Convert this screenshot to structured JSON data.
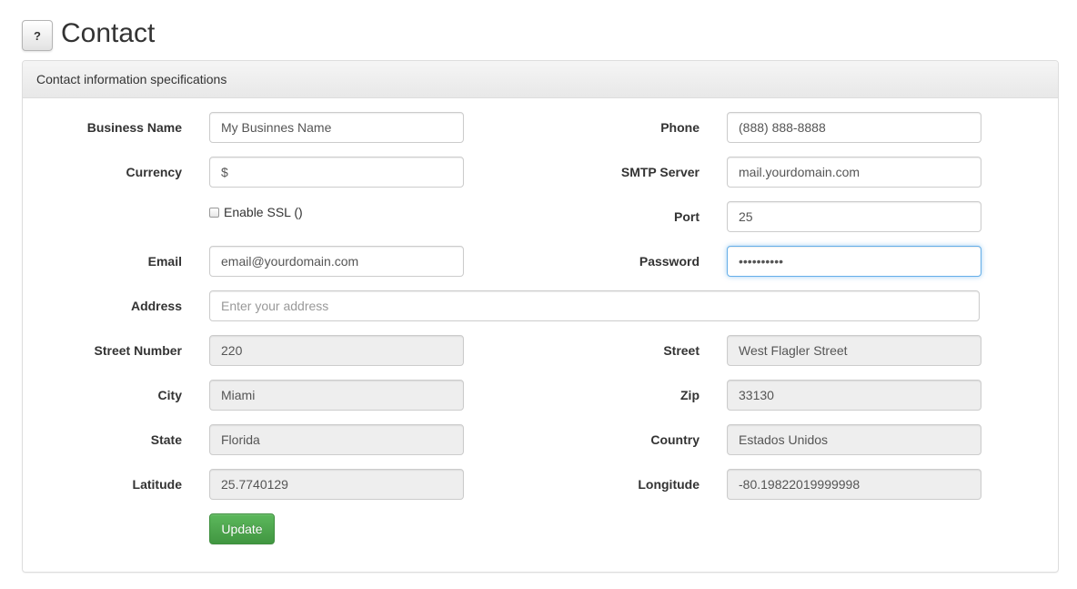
{
  "header": {
    "help_label": "?",
    "title": "Contact"
  },
  "panel": {
    "heading": "Contact information specifications"
  },
  "form": {
    "business_name": {
      "label": "Business Name",
      "value": "My Businnes Name"
    },
    "currency": {
      "label": "Currency",
      "value": "$"
    },
    "enable_ssl": {
      "label": "Enable SSL ()",
      "checked": false
    },
    "email": {
      "label": "Email",
      "value": "email@yourdomain.com"
    },
    "address": {
      "label": "Address",
      "value": "",
      "placeholder": "Enter your address"
    },
    "street_number": {
      "label": "Street Number",
      "value": "220"
    },
    "city": {
      "label": "City",
      "value": "Miami"
    },
    "state": {
      "label": "State",
      "value": "Florida"
    },
    "latitude": {
      "label": "Latitude",
      "value": "25.7740129"
    },
    "phone": {
      "label": "Phone",
      "value": "(888) 888-8888"
    },
    "smtp_server": {
      "label": "SMTP Server",
      "value": "mail.yourdomain.com"
    },
    "port": {
      "label": "Port",
      "value": "25"
    },
    "password": {
      "label": "Password",
      "value": "••••••••••"
    },
    "street": {
      "label": "Street",
      "value": "West Flagler Street"
    },
    "zip": {
      "label": "Zip",
      "value": "33130"
    },
    "country": {
      "label": "Country",
      "value": "Estados Unidos"
    },
    "longitude": {
      "label": "Longitude",
      "value": "-80.19822019999998"
    },
    "update_label": "Update"
  },
  "colors": {
    "primary_button": "#5cb85c",
    "focus_border": "#66afe9",
    "readonly_bg": "#eeeeee"
  }
}
